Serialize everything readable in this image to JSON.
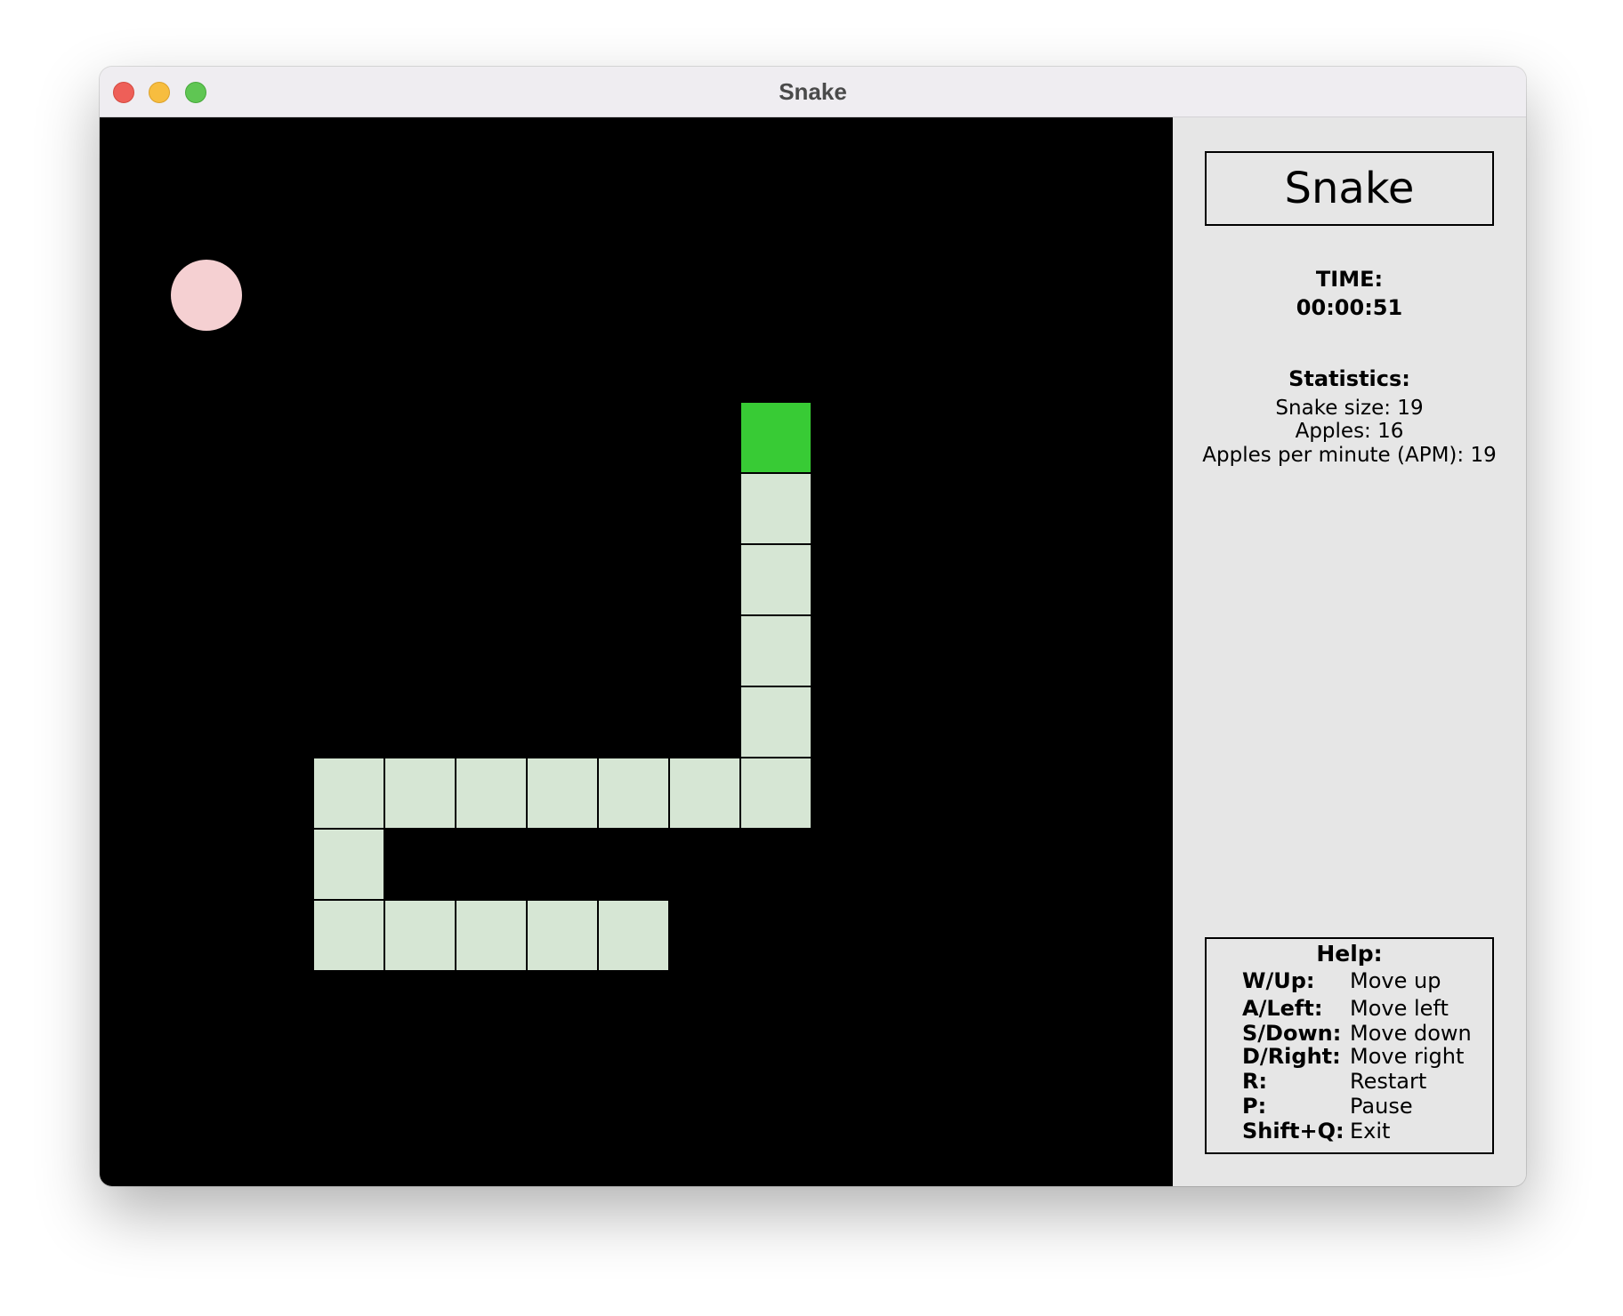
{
  "window": {
    "title": "Snake"
  },
  "game": {
    "snake_body": [
      {
        "col": 9,
        "row": 4
      },
      {
        "col": 9,
        "row": 5
      },
      {
        "col": 9,
        "row": 6
      },
      {
        "col": 9,
        "row": 7
      },
      {
        "col": 9,
        "row": 8
      },
      {
        "col": 9,
        "row": 9
      },
      {
        "col": 8,
        "row": 9
      },
      {
        "col": 7,
        "row": 9
      },
      {
        "col": 6,
        "row": 9
      },
      {
        "col": 5,
        "row": 9
      },
      {
        "col": 4,
        "row": 9
      },
      {
        "col": 3,
        "row": 9
      },
      {
        "col": 3,
        "row": 10
      },
      {
        "col": 3,
        "row": 11
      },
      {
        "col": 4,
        "row": 11
      },
      {
        "col": 5,
        "row": 11
      },
      {
        "col": 6,
        "row": 11
      },
      {
        "col": 7,
        "row": 11
      }
    ],
    "apple": {
      "col": 1,
      "row": 2
    },
    "colors": {
      "head": "#38cb35",
      "body": "#d6e6d4",
      "apple": "#f5d0d2",
      "background": "#000000"
    }
  },
  "sidebar": {
    "title": "Snake",
    "time_label": "TIME:",
    "time_value": "00:00:51",
    "stats_heading": "Statistics:",
    "snake_size": "Snake size: 19",
    "apples": "Apples: 16",
    "apm": "Apples per minute (APM): 19"
  },
  "help": {
    "heading": "Help:",
    "items": [
      {
        "key": "W/Up:",
        "desc": "Move up"
      },
      {
        "key": "A/Left:",
        "desc": "Move left"
      },
      {
        "key": "S/Down:",
        "desc": "Move down"
      },
      {
        "key": "D/Right:",
        "desc": "Move right"
      },
      {
        "key": "R:",
        "desc": "Restart"
      },
      {
        "key": "P:",
        "desc": "Pause"
      },
      {
        "key": "Shift+Q:",
        "desc": "Exit"
      }
    ]
  }
}
